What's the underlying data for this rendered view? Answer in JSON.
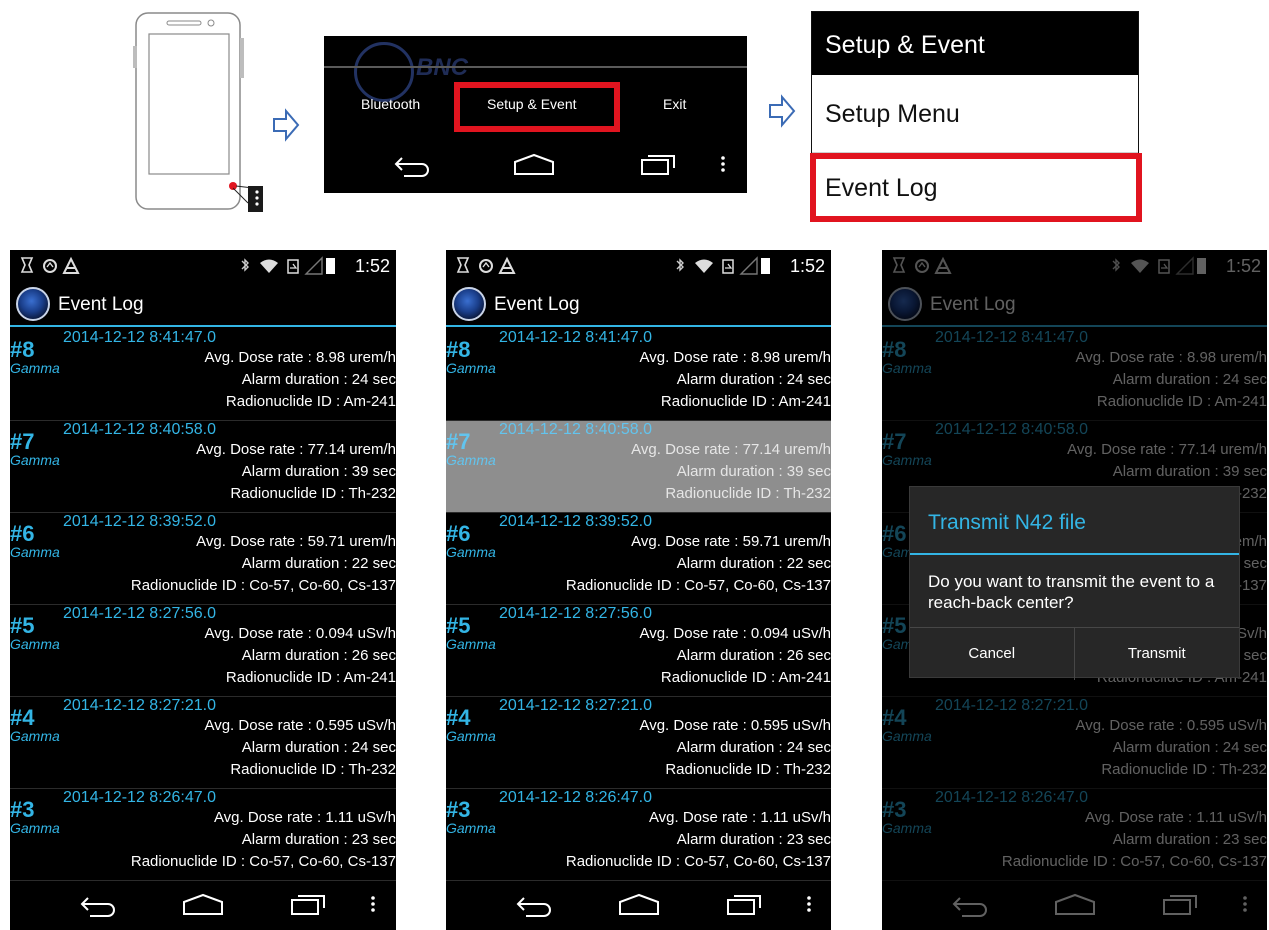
{
  "step1": {
    "menu_icon": "overflow-menu-icon"
  },
  "step2": {
    "brand": "BNC",
    "items": [
      "Bluetooth",
      "Setup & Event",
      "Exit"
    ],
    "highlighted": "Setup & Event"
  },
  "step3": {
    "header": "Setup & Event",
    "items": [
      "Setup Menu",
      "Event Log"
    ],
    "highlighted": "Event Log"
  },
  "screens": {
    "clock": "1:52",
    "title": "Event Log",
    "accent_color": "#33b5e5",
    "selected_row_color": "#8e8e8e"
  },
  "events": [
    {
      "num": "#8",
      "type": "Gamma",
      "datetime": "2014-12-12  8:41:47.0",
      "dose": "Avg. Dose rate : 8.98 urem/h",
      "duration": "Alarm duration : 24 sec",
      "nuclide": "Radionuclide ID : Am-241"
    },
    {
      "num": "#7",
      "type": "Gamma",
      "datetime": "2014-12-12  8:40:58.0",
      "dose": "Avg. Dose rate : 77.14 urem/h",
      "duration": "Alarm duration : 39 sec",
      "nuclide": "Radionuclide ID : Th-232"
    },
    {
      "num": "#6",
      "type": "Gamma",
      "datetime": "2014-12-12  8:39:52.0",
      "dose": "Avg. Dose rate : 59.71 urem/h",
      "duration": "Alarm duration : 22 sec",
      "nuclide": "Radionuclide ID : Co-57, Co-60, Cs-137"
    },
    {
      "num": "#5",
      "type": "Gamma",
      "datetime": "2014-12-12  8:27:56.0",
      "dose": "Avg. Dose rate : 0.094 uSv/h",
      "duration": "Alarm duration : 26 sec",
      "nuclide": "Radionuclide ID : Am-241"
    },
    {
      "num": "#4",
      "type": "Gamma",
      "datetime": "2014-12-12  8:27:21.0",
      "dose": "Avg. Dose rate : 0.595 uSv/h",
      "duration": "Alarm duration : 24 sec",
      "nuclide": "Radionuclide ID : Th-232"
    },
    {
      "num": "#3",
      "type": "Gamma",
      "datetime": "2014-12-12  8:26:47.0",
      "dose": "Avg. Dose rate : 1.11 uSv/h",
      "duration": "Alarm duration : 23 sec",
      "nuclide": "Radionuclide ID : Co-57, Co-60, Cs-137"
    }
  ],
  "dialog": {
    "title": "Transmit N42 file",
    "message": "Do you want to transmit the event to a reach-back center?",
    "cancel": "Cancel",
    "transmit": "Transmit"
  }
}
